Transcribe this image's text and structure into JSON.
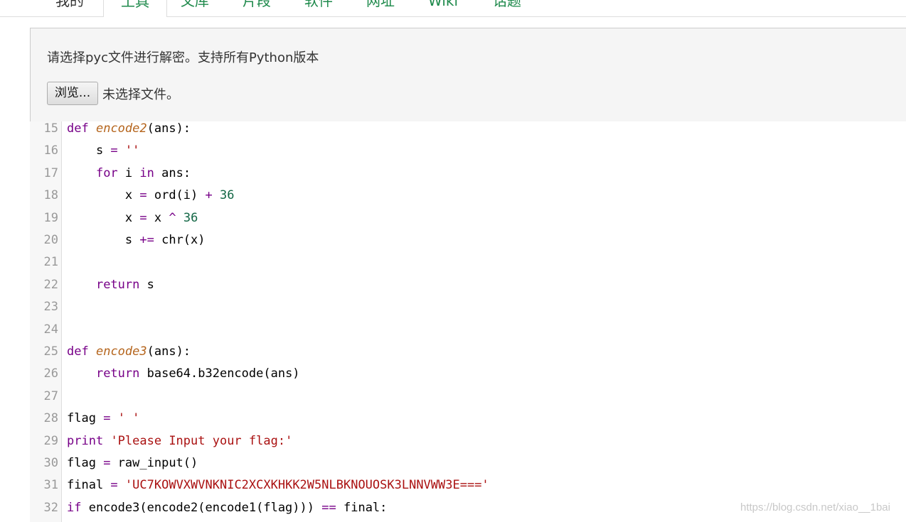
{
  "nav": {
    "tabs": [
      {
        "label": "我的"
      },
      {
        "label": "工具"
      },
      {
        "label": "文库"
      },
      {
        "label": "片段"
      },
      {
        "label": "软件"
      },
      {
        "label": "网址"
      },
      {
        "label": "Wiki"
      },
      {
        "label": "话题"
      }
    ],
    "active_tab": "工具"
  },
  "panel": {
    "hint": "请选择pyc文件进行解密。支持所有Python版本",
    "browse_label": "浏览...",
    "file_status": "未选择文件。"
  },
  "editor": {
    "lines": [
      {
        "n": "15",
        "t": "def encode2(ans):"
      },
      {
        "n": "16",
        "t": "    s = ''"
      },
      {
        "n": "17",
        "t": "    for i in ans:"
      },
      {
        "n": "18",
        "t": "        x = ord(i) + 36"
      },
      {
        "n": "19",
        "t": "        x = x ^ 36"
      },
      {
        "n": "20",
        "t": "        s += chr(x)"
      },
      {
        "n": "21",
        "t": ""
      },
      {
        "n": "22",
        "t": "    return s"
      },
      {
        "n": "23",
        "t": ""
      },
      {
        "n": "24",
        "t": ""
      },
      {
        "n": "25",
        "t": "def encode3(ans):"
      },
      {
        "n": "26",
        "t": "    return base64.b32encode(ans)"
      },
      {
        "n": "27",
        "t": ""
      },
      {
        "n": "28",
        "t": "flag = ' '"
      },
      {
        "n": "29",
        "t": "print 'Please Input your flag:'"
      },
      {
        "n": "30",
        "t": "flag = raw_input()"
      },
      {
        "n": "31",
        "t": "final = 'UC7KOWVXWVNKNIC2XCXKHKK2W5NLBKNOUOSK3LNNVWW3E==='"
      },
      {
        "n": "32",
        "t": "if encode3(encode2(encode1(flag))) == final:"
      }
    ]
  },
  "watermark": "https://blog.csdn.net/xiao__1bai",
  "colors": {
    "tab_text": "#1f8a4c",
    "keyword": "#770088",
    "string": "#aa1111",
    "function_name": "#b5651d",
    "line_number": "#999999",
    "panel_bg": "#f5f5f5"
  }
}
